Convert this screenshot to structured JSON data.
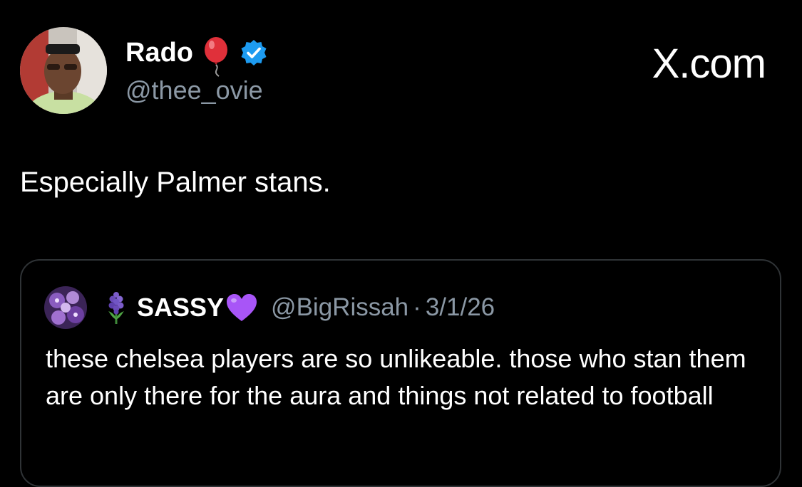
{
  "site_label": "X.com",
  "author": {
    "name": "Rado",
    "handle": "@thee_ovie",
    "name_emoji": "balloon-icon",
    "verified": true,
    "avatar_icon": "person-avatar"
  },
  "tweet": {
    "text": "Especially Palmer stans."
  },
  "quoted_tweet": {
    "avatar_icon": "purple-flowers-avatar",
    "name_prefix_emoji": "hyacinth-icon",
    "name": "SASSY",
    "name_suffix_emoji": "purple-heart-icon",
    "handle": "@BigRissah",
    "separator": "·",
    "date": "3/1/26",
    "text": "these chelsea players are so unlikeable. those who stan them are only there for the aura and things not related to football"
  },
  "colors": {
    "background": "#000000",
    "primary_text": "#ffffff",
    "secondary_text": "#8b98a5",
    "verified_badge": "#1d9bf0",
    "border": "#2f3336",
    "balloon": "#e0303a",
    "heart": "#a855f7"
  }
}
